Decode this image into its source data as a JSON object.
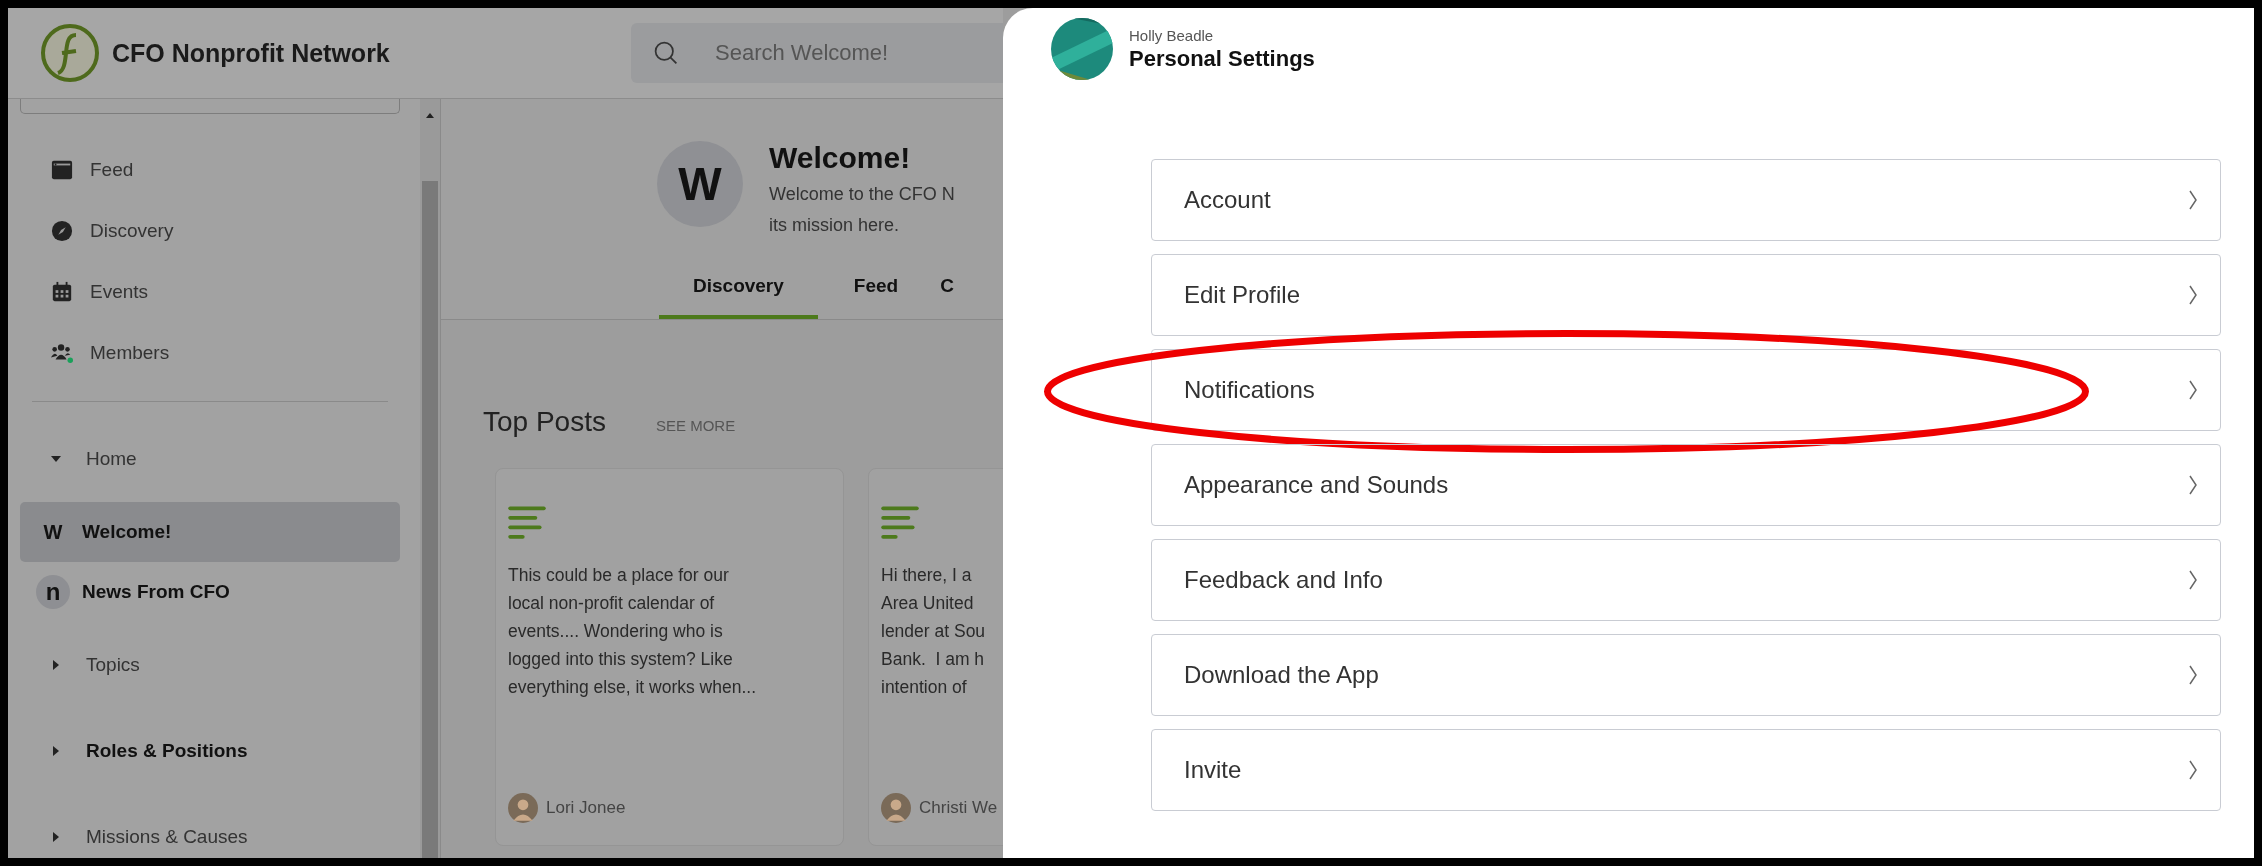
{
  "header": {
    "title": "CFO Nonprofit Network",
    "search": {
      "placeholder": "Search Welcome!"
    }
  },
  "sidebar": {
    "nav": [
      {
        "label": "Feed",
        "kind": "feed"
      },
      {
        "label": "Discovery",
        "kind": "discovery"
      },
      {
        "label": "Events",
        "kind": "events"
      },
      {
        "label": "Members",
        "kind": "members"
      }
    ],
    "sections": [
      {
        "label": "Home",
        "expanded": true,
        "unread": false,
        "children": [
          {
            "label": "Welcome!",
            "badge": "W",
            "selected": true
          },
          {
            "label": "News From CFO",
            "badge": "n",
            "selected": false
          }
        ]
      },
      {
        "label": "Topics",
        "expanded": false,
        "unread": false
      },
      {
        "label": "Roles & Positions",
        "expanded": false,
        "unread": true
      },
      {
        "label": "Missions & Causes",
        "expanded": false,
        "unread": false
      }
    ]
  },
  "community": {
    "badge": "W",
    "title": "Welcome!",
    "description": "Welcome to the CFO N\nits mission here.",
    "tabs": [
      {
        "label": "Discovery",
        "selected": true
      },
      {
        "label": "Feed",
        "selected": false
      },
      {
        "label": "C",
        "selected": false
      }
    ]
  },
  "top_posts": {
    "title": "Top Posts",
    "see_more": "SEE MORE",
    "cards": [
      {
        "text": "This could be a place for our\nlocal non-profit calendar of\nevents.... Wondering who is\nlogged into this system? Like\neverything else, it works when...",
        "author": "Lori Jonee"
      },
      {
        "text": "Hi there, I a\nArea United\nlender at Sou\nBank.  I am h\nintention of",
        "author": "Christi We"
      }
    ]
  },
  "settings_panel": {
    "user": "Holly Beadle",
    "title": "Personal Settings",
    "items": [
      {
        "label": "Account",
        "highlighted": false
      },
      {
        "label": "Edit Profile",
        "highlighted": false
      },
      {
        "label": "Notifications",
        "highlighted": true
      },
      {
        "label": "Appearance and Sounds",
        "highlighted": false
      },
      {
        "label": "Feedback and Info",
        "highlighted": false
      },
      {
        "label": "Download the App",
        "highlighted": false
      },
      {
        "label": "Invite",
        "highlighted": false
      }
    ]
  }
}
